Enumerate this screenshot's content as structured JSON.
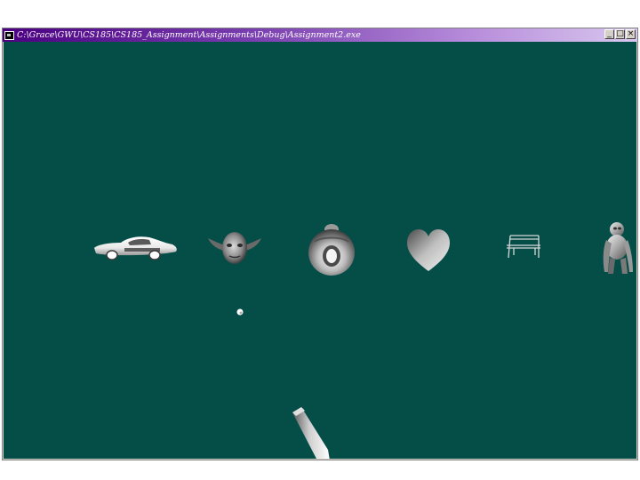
{
  "window": {
    "title": "C:\\Grace\\GWU\\CS185\\CS185_Assignment\\Assignments\\Debug\\Assignment2.exe",
    "minimize_glyph": "_",
    "maximize_glyph": "□",
    "close_glyph": "×"
  },
  "scene": {
    "background_color": "#054e48",
    "objects": [
      "car-model",
      "yoda-head-model",
      "bust-model",
      "heart-model",
      "bench-model",
      "gorilla-model",
      "small-sphere",
      "gun-barrel"
    ]
  }
}
